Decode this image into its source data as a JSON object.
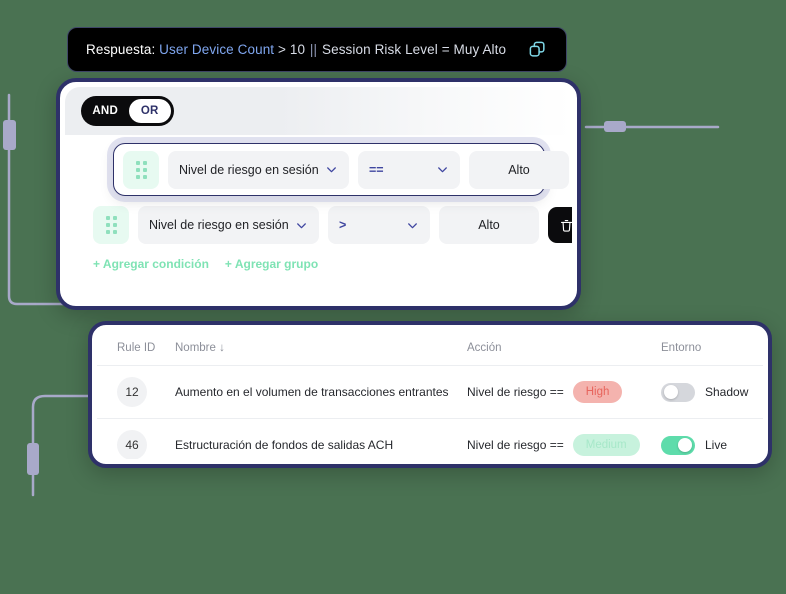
{
  "page": {
    "background_color": "#4a7252",
    "accent_navy": "#2e3169",
    "accent_green": "#7fe3b4",
    "wire_color": "#a8a9c9"
  },
  "expression_bar": {
    "label": "Respuesta:",
    "field": "User Device Count",
    "operator": " > ",
    "value": "10",
    "separator": "||",
    "second_clause": "Session Risk Level = Muy Alto",
    "copy_icon": "copy-icon"
  },
  "builder": {
    "logic_toggle": {
      "options": [
        "AND",
        "OR"
      ],
      "selected": "OR"
    },
    "conditions": [
      {
        "drag_icon": "drag-handle-icon",
        "field": "Nivel de riesgo en sesión",
        "operator": "==",
        "value": "Alto",
        "delete_icon": "trash-icon",
        "highlighted": true
      },
      {
        "drag_icon": "drag-handle-icon",
        "field": "Nivel de riesgo en sesión",
        "operator": ">",
        "value": "Alto",
        "delete_icon": "trash-icon",
        "highlighted": false
      }
    ],
    "add_condition_label": "+ Agregar condición",
    "add_group_label": "+ Agregar grupo"
  },
  "rules_table": {
    "columns": [
      {
        "key": "rule_id",
        "label": "Rule ID"
      },
      {
        "key": "nombre",
        "label": "Nombre ↓"
      },
      {
        "key": "accion",
        "label": "Acción"
      },
      {
        "key": "entorno",
        "label": "Entorno"
      }
    ],
    "rows": [
      {
        "rule_id": "12",
        "nombre": "Aumento en el volumen de transacciones entrantes",
        "action_text": "Nivel de riesgo ==",
        "action_badge": "High",
        "action_badge_variant": "high",
        "env_enabled": false,
        "env_label": "Shadow"
      },
      {
        "rule_id": "46",
        "nombre": "Estructuración de fondos de salidas ACH",
        "action_text": "Nivel de riesgo ==",
        "action_badge": "Medium",
        "action_badge_variant": "medium",
        "env_enabled": true,
        "env_label": "Live"
      }
    ]
  }
}
